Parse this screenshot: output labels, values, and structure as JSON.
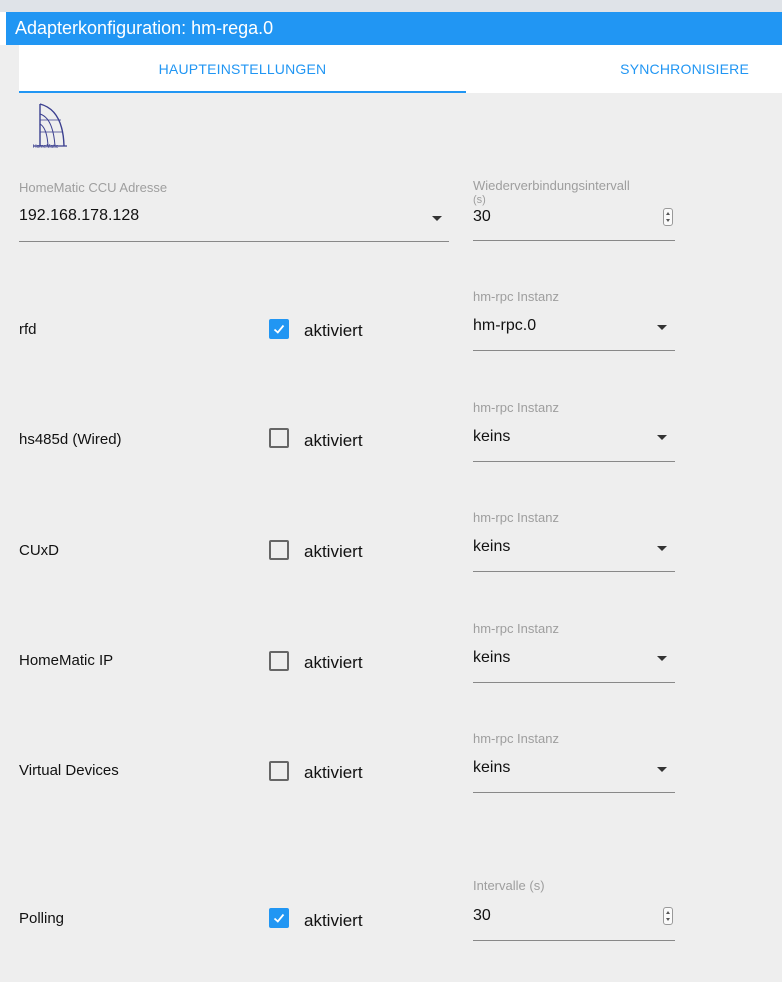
{
  "window": {
    "title": "Adapterkonfiguration: hm-rega.0"
  },
  "tabs": [
    {
      "label": "HAUPTEINSTELLUNGEN",
      "active": true
    },
    {
      "label": "SYNCHRONISIERE",
      "active": false
    }
  ],
  "logo": {
    "text": "HomeMatic",
    "icon": "homematic-logo"
  },
  "ccu": {
    "label": "HomeMatic CCU Adresse",
    "value": "192.168.178.128"
  },
  "reconnect": {
    "label_line1": "Wiederverbindungsintervall",
    "label_line2": "(s)",
    "value": "30"
  },
  "instance_label": "hm-rpc Instanz",
  "checkbox_label": "aktiviert",
  "rows": [
    {
      "name": "rfd",
      "checked": true,
      "instance": "hm-rpc.0"
    },
    {
      "name": "hs485d (Wired)",
      "checked": false,
      "instance": "keins"
    },
    {
      "name": "CUxD",
      "checked": false,
      "instance": "keins"
    },
    {
      "name": "HomeMatic IP",
      "checked": false,
      "instance": "keins"
    },
    {
      "name": "Virtual Devices",
      "checked": false,
      "instance": "keins"
    }
  ],
  "polling": {
    "name": "Polling",
    "checked": true,
    "interval_label": "Intervalle (s)",
    "interval_value": "30"
  },
  "colors": {
    "accent": "#2196f3",
    "panel": "#eeeeee"
  }
}
